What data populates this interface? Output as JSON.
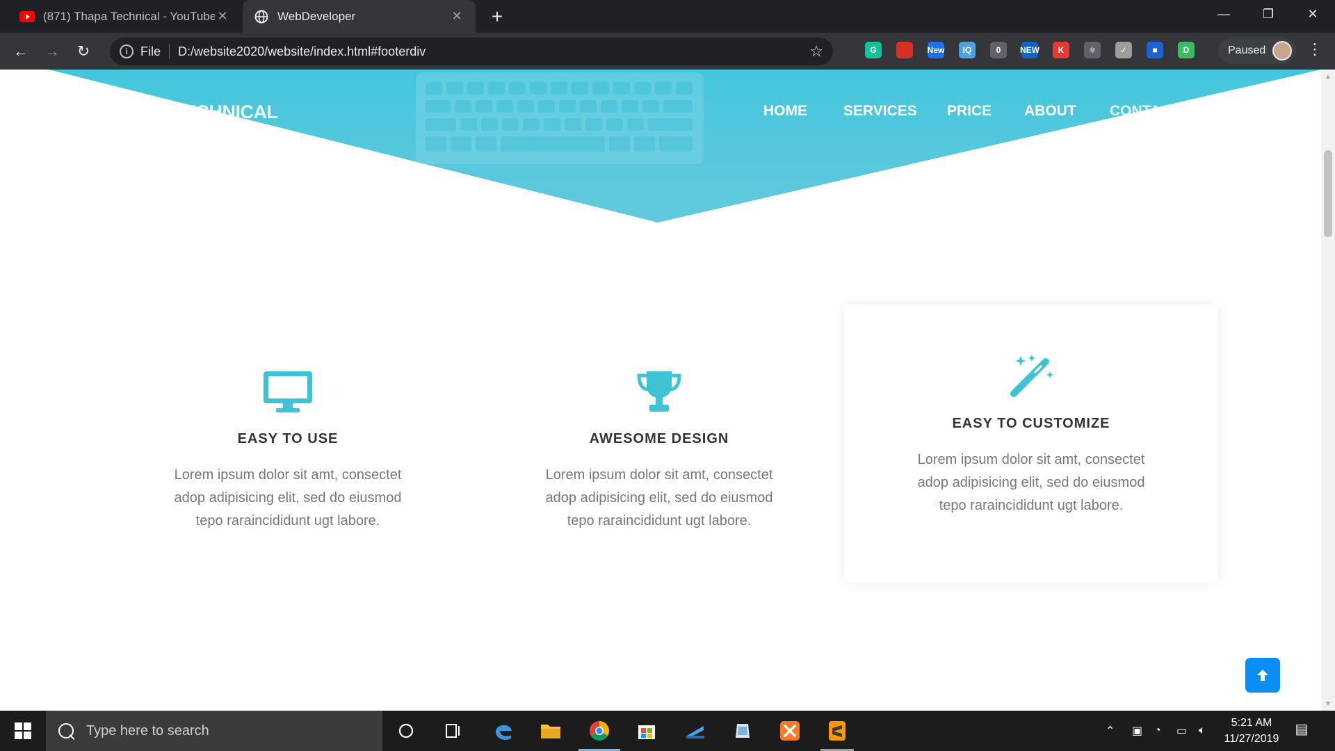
{
  "browser": {
    "tabs": [
      {
        "title": "(871) Thapa Technical - YouTube",
        "icon": "youtube-icon"
      },
      {
        "title": "WebDeveloper",
        "icon": "globe-icon"
      }
    ],
    "new_tab_label": "+",
    "close_glyph": "✕",
    "address": {
      "scheme": "File",
      "url": "D:/website2020/website/index.html#footerdiv"
    },
    "profile": {
      "status": "Paused"
    },
    "extensions": [
      {
        "name": "grammarly-icon",
        "label": "G",
        "color": "#15c39a"
      },
      {
        "name": "bookmark-red-icon",
        "label": "",
        "color": "#d93025"
      },
      {
        "name": "new-badge-icon",
        "label": "New",
        "color": "#1a73e8"
      },
      {
        "name": "iq-icon",
        "label": "IQ",
        "color": "#4aa3df"
      },
      {
        "name": "counter-icon",
        "label": "0",
        "color": "#5f6368"
      },
      {
        "name": "new-ext-icon",
        "label": "NEW",
        "color": "#1565c0"
      },
      {
        "name": "k-icon",
        "label": "K",
        "color": "#e53935"
      },
      {
        "name": "atom-icon",
        "label": "⚛",
        "color": "#5f6368"
      },
      {
        "name": "check-circle-icon",
        "label": "✓",
        "color": "#9e9e9e"
      },
      {
        "name": "square-icon",
        "label": "■",
        "color": "#1e63d6"
      },
      {
        "name": "d-icon",
        "label": "D",
        "color": "#3dbb61"
      }
    ]
  },
  "page": {
    "brand": "TECHNICAL",
    "nav": [
      "HOME",
      "SERVICES",
      "PRICE",
      "ABOUT",
      "CONTACT"
    ],
    "accent": "#3ec3d5",
    "features": [
      {
        "icon": "monitor-icon",
        "title": "EASY TO USE",
        "lines": [
          "Lorem ipsum dolor sit amt, consectet",
          "adop adipisicing elit, sed do eiusmod",
          "tepo raraincididunt ugt labore."
        ]
      },
      {
        "icon": "trophy-icon",
        "title": "AWESOME DESIGN",
        "lines": [
          "Lorem ipsum dolor sit amt, consectet",
          "adop adipisicing elit, sed do eiusmod",
          "tepo raraincididunt ugt labore."
        ]
      },
      {
        "icon": "magic-wand-icon",
        "title": "EASY TO CUSTOMIZE",
        "lines": [
          "Lorem ipsum dolor sit amt, consectet",
          "adop adipisicing elit, sed do eiusmod",
          "tepo raraincididunt ugt labore."
        ]
      }
    ]
  },
  "taskbar": {
    "search_placeholder": "Type here to search",
    "time": "5:21 AM",
    "date": "11/27/2019"
  }
}
